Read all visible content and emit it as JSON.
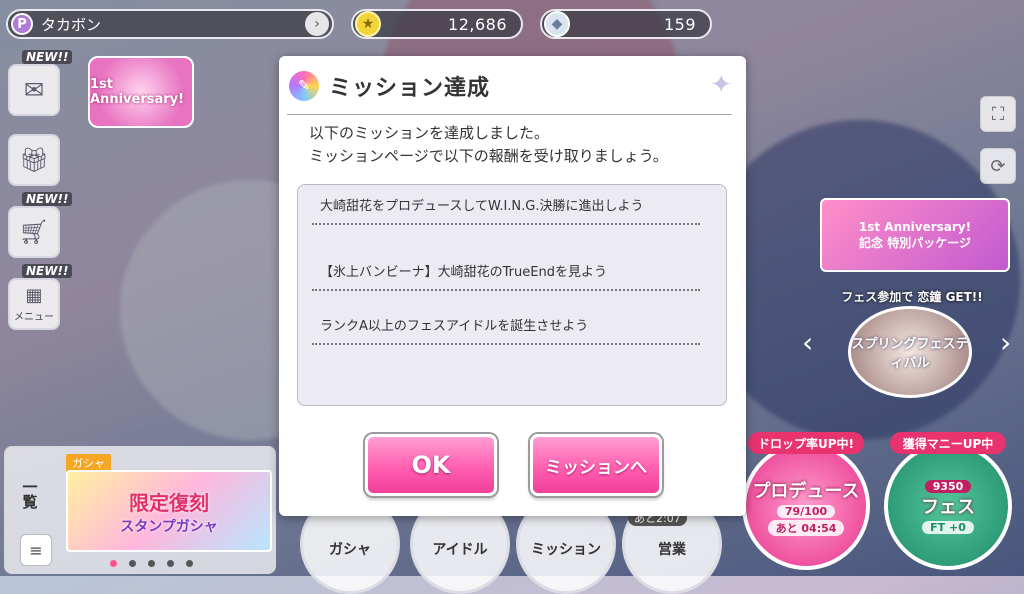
{
  "header": {
    "player_badge": "P",
    "player_name": "タカボン",
    "coins": "12,686",
    "gems": "159"
  },
  "left_side": {
    "new_tag": "NEW!!",
    "menu_label": "メニュー",
    "anniversary": "1st Anniversary!"
  },
  "right_side": {
    "package_banner_line1": "1st Anniversary!",
    "package_banner_line2": "記念 特別パッケージ",
    "fes_banner_title": "フェス参加で 恋鐘 GET!!",
    "fes_banner_name": "スプリングフェスティバル"
  },
  "gacha": {
    "ichiran": "一覧",
    "tag": "ガシャ",
    "banner_main": "限定復刻",
    "banner_sub": "スタンプガシャ"
  },
  "nav": {
    "gacha": "ガシャ",
    "idol": "アイドル",
    "mission": "ミッション",
    "eigyo": "営業",
    "eigyo_timer": "あと2:07",
    "produce_badge": "ドロップ率UP中!",
    "produce_label": "プロデュース",
    "produce_stamina": "79/100",
    "produce_timer": "あと 04:54",
    "fes_badge": "獲得マニーUP中",
    "fes_label": "フェス",
    "fes_value": "9350",
    "fes_ft": "FT +0"
  },
  "dialog": {
    "title": "ミッション達成",
    "message_line1": "以下のミッションを達成しました。",
    "message_line2": "ミッションページで以下の報酬を受け取りましょう。",
    "missions": [
      "大崎甜花をプロデュースしてW.I.N.G.決勝に進出しよう",
      "【氷上バンビーナ】大崎甜花のTrueEndを見よう",
      "ランクA以上のフェスアイドルを誕生させよう"
    ],
    "ok_label": "OK",
    "mission_button_label": "ミッションへ"
  }
}
